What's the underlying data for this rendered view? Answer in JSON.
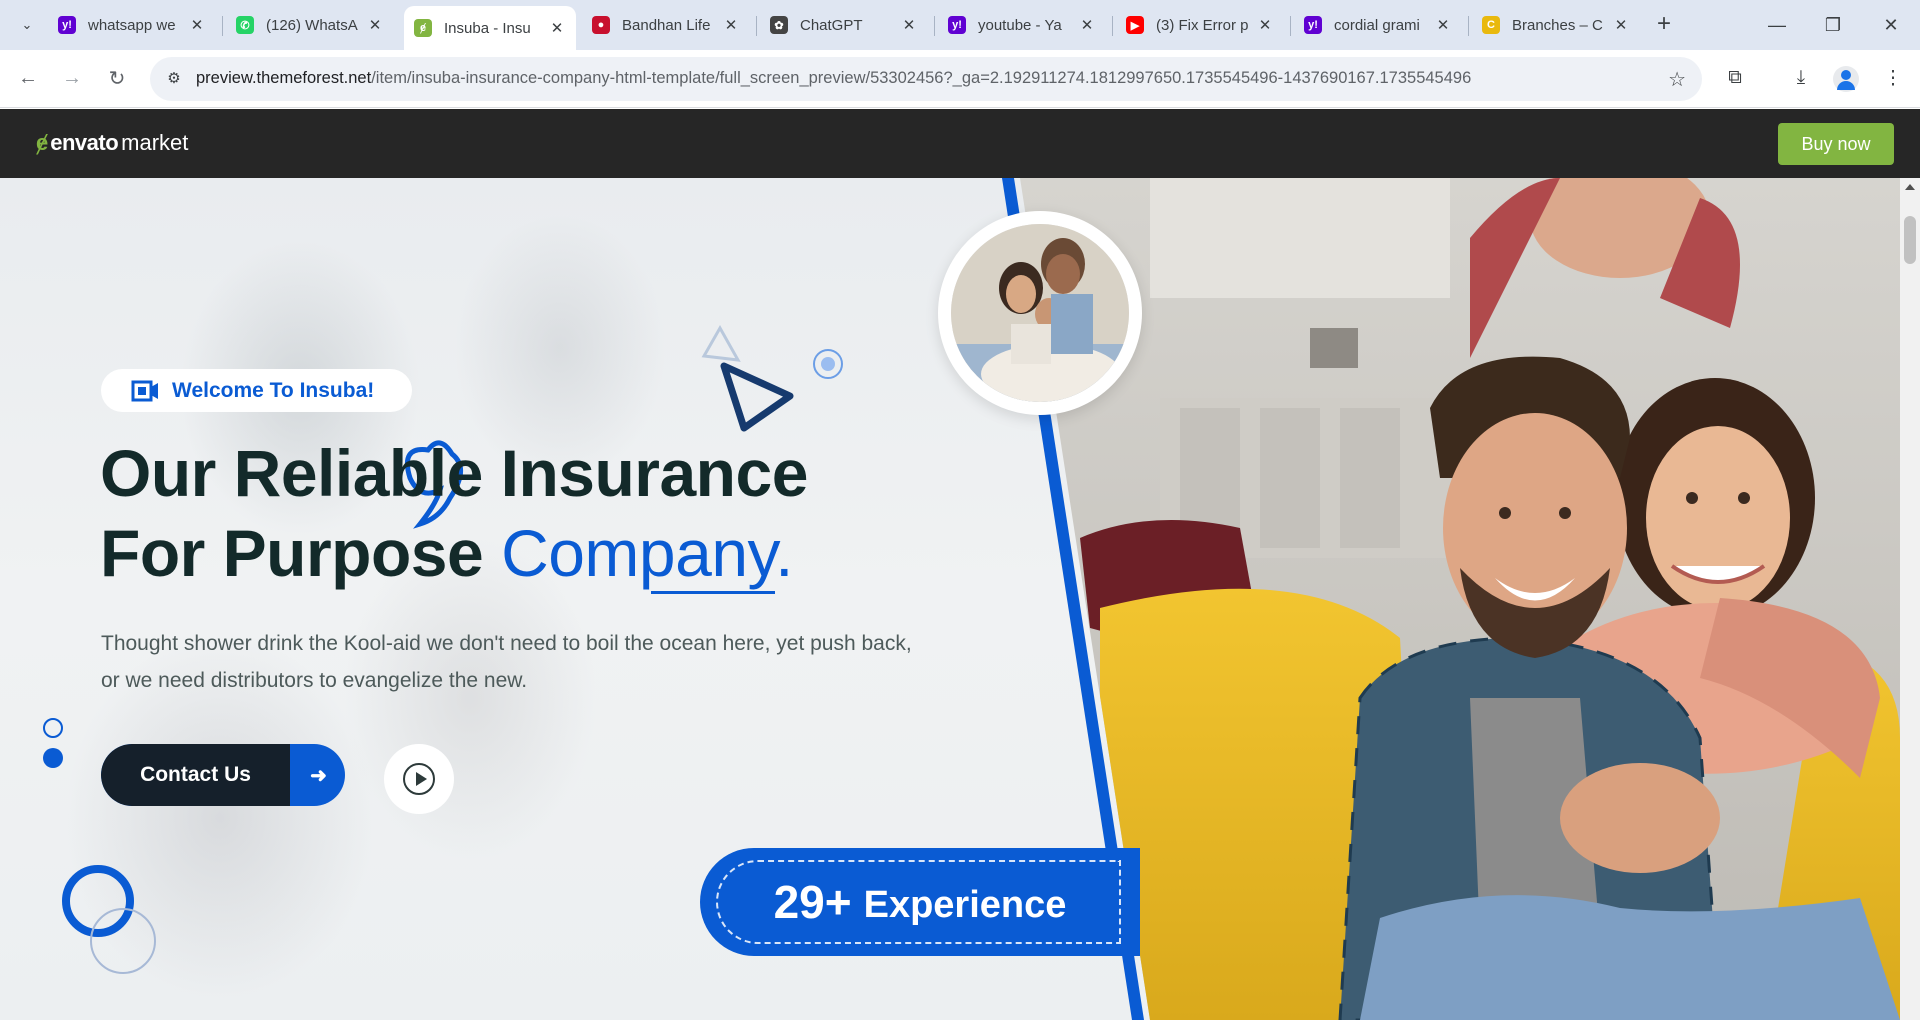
{
  "browser": {
    "tabs": [
      {
        "title": "whatsapp we",
        "favicon": "yahoo-icon",
        "color": "#6001d2",
        "active": false
      },
      {
        "title": "(126) WhatsA",
        "favicon": "whatsapp-icon",
        "color": "#25d366",
        "active": false
      },
      {
        "title": "Insuba - Insu",
        "favicon": "envato-icon",
        "color": "#82b541",
        "active": true
      },
      {
        "title": "Bandhan Life",
        "favicon": "bandhan-icon",
        "color": "#c8102e",
        "active": false
      },
      {
        "title": "ChatGPT",
        "favicon": "chatgpt-icon",
        "color": "#444444",
        "active": false
      },
      {
        "title": "youtube - Ya",
        "favicon": "yahoo-icon",
        "color": "#6001d2",
        "active": false
      },
      {
        "title": "(3) Fix Error p",
        "favicon": "youtube-icon",
        "color": "#ff0000",
        "active": false
      },
      {
        "title": "cordial grami",
        "favicon": "yahoo-icon",
        "color": "#6001d2",
        "active": false
      },
      {
        "title": "Branches – C",
        "favicon": "branches-icon",
        "color": "#e9b90e",
        "active": false
      }
    ],
    "url_host": "preview.themeforest.net",
    "url_path": "/item/insuba-insurance-company-html-template/full_screen_preview/53302456?_ga=2.192911274.1812997650.1735545496-1437690167.1735545496"
  },
  "envato": {
    "logo_bold": "envato",
    "logo_light": "market",
    "buy_label": "Buy now",
    "brand_color": "#82b541"
  },
  "hero": {
    "welcome": "Welcome To Insuba!",
    "headline_line1": "Our Reliable Insurance",
    "headline_line2_dark": "For Purpose ",
    "headline_line2_accent": "Company.",
    "subtext": "Thought shower drink the Kool-aid we don't need to boil the ocean here, yet push back, or we need distributors to evangelize the new.",
    "contact_label": "Contact Us",
    "badge_number": "29+",
    "badge_label": "Experience",
    "accent_color": "#0a5bd3",
    "dark_color": "#132a2a"
  }
}
